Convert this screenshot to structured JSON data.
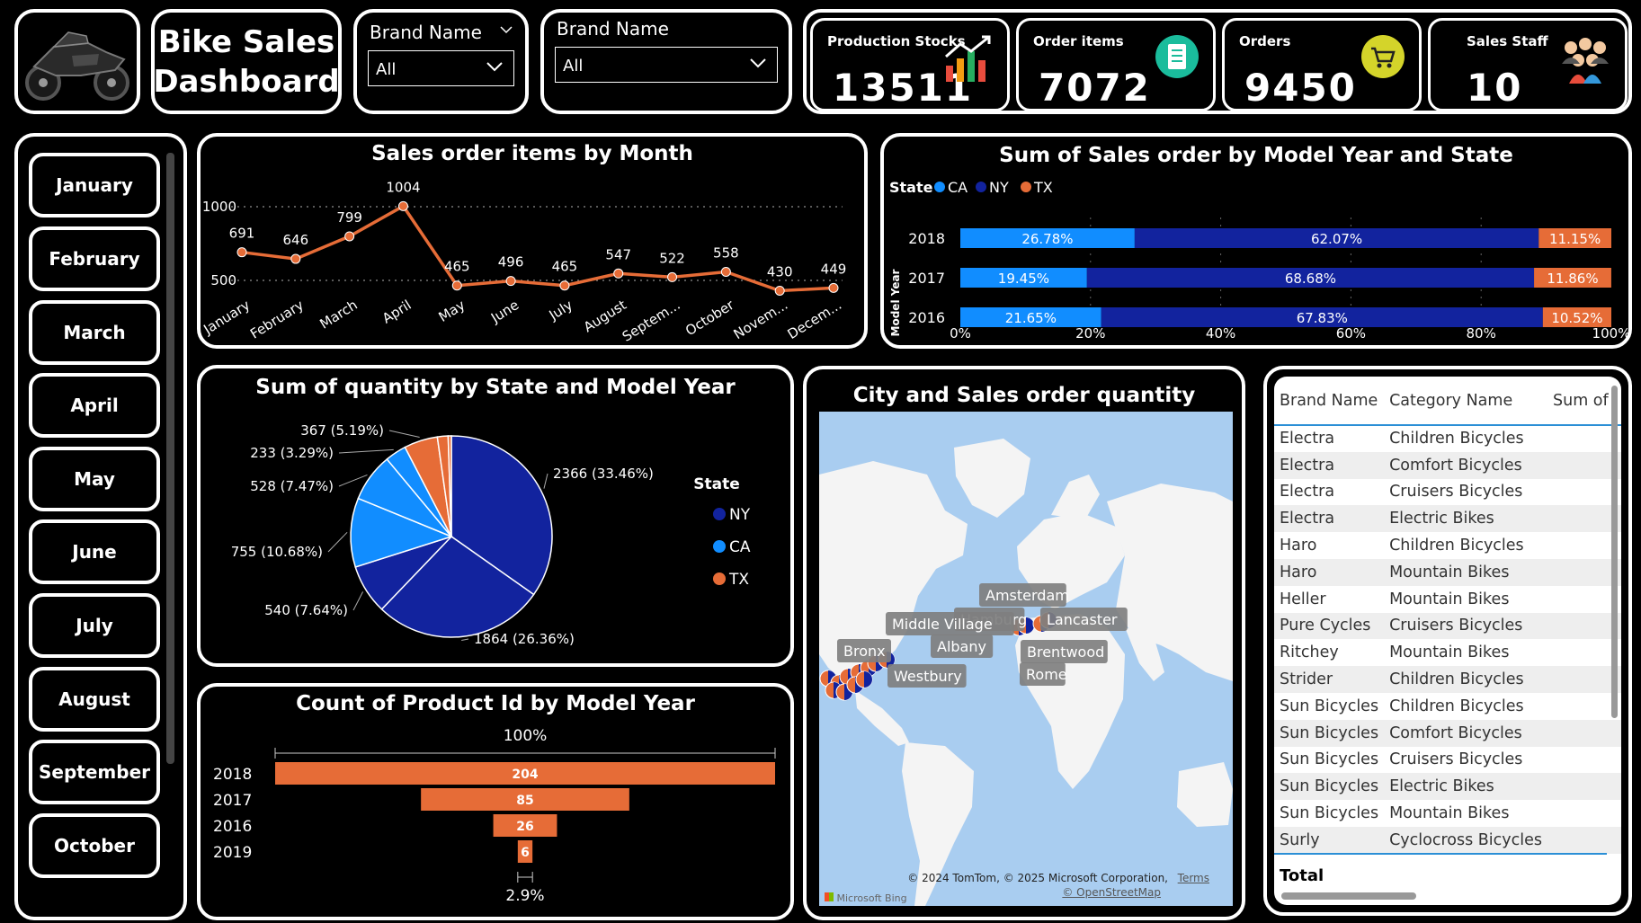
{
  "header": {
    "title_line1": "Bike Sales",
    "title_line2": "Dashboard",
    "slicer1": {
      "label": "Brand Name",
      "value": "All"
    },
    "slicer2": {
      "label": "Brand Name",
      "value": "All"
    }
  },
  "kpis": [
    {
      "label": "Production Stocks",
      "value": "13511",
      "icon": "bar-chart-up-icon"
    },
    {
      "label": "Order items",
      "value": "7072",
      "icon": "document-icon"
    },
    {
      "label": "Orders",
      "value": "9450",
      "icon": "cart-icon"
    },
    {
      "label": "Sales Staff",
      "value": "10",
      "icon": "people-icon"
    }
  ],
  "months": [
    "January",
    "February",
    "March",
    "April",
    "May",
    "June",
    "July",
    "August",
    "September",
    "October"
  ],
  "colors": {
    "CA": "#118dff",
    "NY": "#12239e",
    "TX": "#e66c37",
    "line": "#e66c37"
  },
  "charts": {
    "line": {
      "title": "Sales order items by Month",
      "chart_data": {
        "type": "line",
        "categories": [
          "January",
          "February",
          "March",
          "April",
          "May",
          "June",
          "July",
          "August",
          "Septem...",
          "October",
          "Novem...",
          "Decem..."
        ],
        "values": [
          691,
          646,
          799,
          1004,
          465,
          496,
          465,
          547,
          522,
          558,
          430,
          449
        ],
        "labels": [
          "691",
          "646",
          "799",
          "1004",
          "465",
          "496",
          "465",
          "547",
          "522",
          "558",
          "430",
          "449"
        ],
        "y_ticks": [
          "1000",
          "500"
        ],
        "ylim": [
          450,
          1050
        ]
      }
    },
    "stacked": {
      "title": "Sum of Sales order by Model Year and State",
      "legend_title": "State",
      "legend": [
        "CA",
        "NY",
        "TX"
      ],
      "ylabel": "Model Year",
      "chart_data": {
        "type": "bar",
        "categories": [
          "2018",
          "2017",
          "2016"
        ],
        "series": [
          {
            "name": "CA",
            "values": [
              26.78,
              19.45,
              21.65
            ],
            "labels": [
              "26.78%",
              "19.45%",
              "21.65%"
            ]
          },
          {
            "name": "NY",
            "values": [
              62.07,
              68.68,
              67.83
            ],
            "labels": [
              "62.07%",
              "68.68%",
              "67.83%"
            ]
          },
          {
            "name": "TX",
            "values": [
              11.15,
              11.86,
              10.52
            ],
            "labels": [
              "11.15%",
              "11.86%",
              "10.52%"
            ]
          }
        ],
        "x_ticks": [
          "0%",
          "20%",
          "40%",
          "60%",
          "80%",
          "100%"
        ],
        "xlim": [
          0,
          100
        ]
      }
    },
    "pie": {
      "title": "Sum of quantity by State and Model Year",
      "legend_title": "State",
      "legend": [
        "NY",
        "CA",
        "TX"
      ],
      "chart_data": {
        "type": "pie",
        "slices": [
          {
            "state": "NY",
            "value": 2366,
            "label": "2366 (33.46%)"
          },
          {
            "state": "NY",
            "value": 1864,
            "label": "1864 (26.36%)"
          },
          {
            "state": "NY",
            "value": 540,
            "label": "540 (7.64%)"
          },
          {
            "state": "CA",
            "value": 755,
            "label": "755 (10.68%)"
          },
          {
            "state": "CA",
            "value": 528,
            "label": "528 (7.47%)"
          },
          {
            "state": "CA",
            "value": 233,
            "label": "233 (3.29%)"
          },
          {
            "state": "TX",
            "value": 367,
            "label": "367 (5.19%)"
          },
          {
            "state": "TX",
            "value": 117,
            "label": ""
          },
          {
            "state": "TX",
            "value": 35,
            "label": ""
          }
        ]
      }
    },
    "funnel": {
      "title": "Count of Product Id by Model Year",
      "top_label": "100%",
      "bottom_label": "2.9%",
      "chart_data": {
        "type": "bar",
        "categories": [
          "2018",
          "2017",
          "2016",
          "2019"
        ],
        "values": [
          204,
          85,
          26,
          6
        ],
        "labels": [
          "204",
          "85",
          "26",
          "6"
        ]
      }
    },
    "map": {
      "title": "City and Sales order quantity",
      "cities": [
        "Amsterdam",
        "Hamburg",
        "Lancaster",
        "Middle Village",
        "Albany",
        "Brentwood",
        "Bronx",
        "Westbury",
        "Rome"
      ],
      "attribution": "© 2024 TomTom, © 2025 Microsoft Corporation,",
      "terms": "Terms",
      "osm": "© OpenStreetMap",
      "bing": "Microsoft Bing"
    }
  },
  "table": {
    "headers": [
      "Brand Name",
      "Category Name",
      "Sum of"
    ],
    "rows": [
      [
        "Electra",
        "Children Bicycles"
      ],
      [
        "Electra",
        "Comfort Bicycles"
      ],
      [
        "Electra",
        "Cruisers Bicycles"
      ],
      [
        "Electra",
        "Electric Bikes"
      ],
      [
        "Haro",
        "Children Bicycles"
      ],
      [
        "Haro",
        "Mountain Bikes"
      ],
      [
        "Heller",
        "Mountain Bikes"
      ],
      [
        "Pure Cycles",
        "Cruisers Bicycles"
      ],
      [
        "Ritchey",
        "Mountain Bikes"
      ],
      [
        "Strider",
        "Children Bicycles"
      ],
      [
        "Sun Bicycles",
        "Children Bicycles"
      ],
      [
        "Sun Bicycles",
        "Comfort Bicycles"
      ],
      [
        "Sun Bicycles",
        "Cruisers Bicycles"
      ],
      [
        "Sun Bicycles",
        "Electric Bikes"
      ],
      [
        "Sun Bicycles",
        "Mountain Bikes"
      ],
      [
        "Surly",
        "Cyclocross Bicycles"
      ]
    ],
    "total_label": "Total"
  }
}
